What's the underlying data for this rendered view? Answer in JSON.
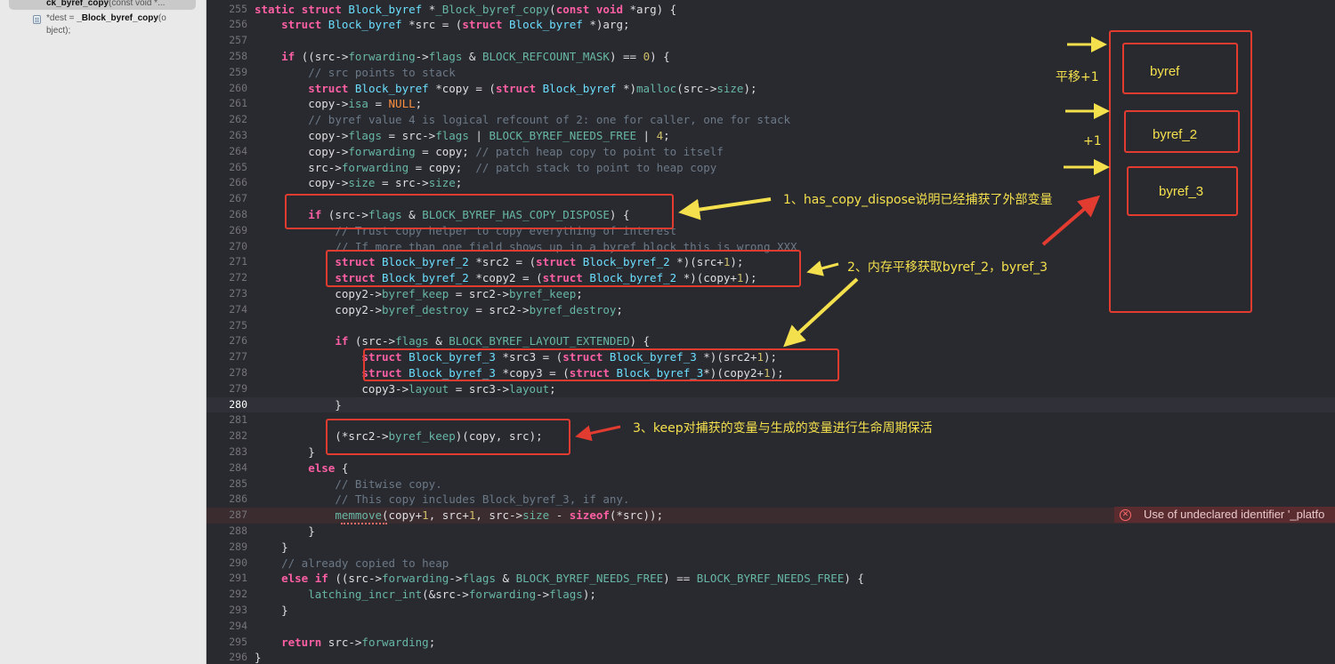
{
  "sidebar": {
    "selected_title": "ck_byref_copy",
    "selected_suffix": "(const void *...",
    "item_prefix": "*dest = ",
    "item_name": "_Block_byref_copy",
    "item_suffix": "(o",
    "item_line2": "bject);"
  },
  "editor": {
    "current_line": 280,
    "error_line": 287,
    "lines": [
      {
        "n": 255,
        "t": "static struct Block_byref *_Block_byref_copy(const void *arg) {"
      },
      {
        "n": 256,
        "t": "    struct Block_byref *src = (struct Block_byref *)arg;"
      },
      {
        "n": 257,
        "t": ""
      },
      {
        "n": 258,
        "t": "    if ((src->forwarding->flags & BLOCK_REFCOUNT_MASK) == 0) {"
      },
      {
        "n": 259,
        "t": "        // src points to stack"
      },
      {
        "n": 260,
        "t": "        struct Block_byref *copy = (struct Block_byref *)malloc(src->size);"
      },
      {
        "n": 261,
        "t": "        copy->isa = NULL;"
      },
      {
        "n": 262,
        "t": "        // byref value 4 is logical refcount of 2: one for caller, one for stack"
      },
      {
        "n": 263,
        "t": "        copy->flags = src->flags | BLOCK_BYREF_NEEDS_FREE | 4;"
      },
      {
        "n": 264,
        "t": "        copy->forwarding = copy; // patch heap copy to point to itself"
      },
      {
        "n": 265,
        "t": "        src->forwarding = copy;  // patch stack to point to heap copy"
      },
      {
        "n": 266,
        "t": "        copy->size = src->size;"
      },
      {
        "n": 267,
        "t": ""
      },
      {
        "n": 268,
        "t": "        if (src->flags & BLOCK_BYREF_HAS_COPY_DISPOSE) {"
      },
      {
        "n": 269,
        "t": "            // Trust copy helper to copy everything of interest"
      },
      {
        "n": 270,
        "t": "            // If more than one field shows up in a byref block this is wrong XXX"
      },
      {
        "n": 271,
        "t": "            struct Block_byref_2 *src2 = (struct Block_byref_2 *)(src+1);"
      },
      {
        "n": 272,
        "t": "            struct Block_byref_2 *copy2 = (struct Block_byref_2 *)(copy+1);"
      },
      {
        "n": 273,
        "t": "            copy2->byref_keep = src2->byref_keep;"
      },
      {
        "n": 274,
        "t": "            copy2->byref_destroy = src2->byref_destroy;"
      },
      {
        "n": 275,
        "t": ""
      },
      {
        "n": 276,
        "t": "            if (src->flags & BLOCK_BYREF_LAYOUT_EXTENDED) {"
      },
      {
        "n": 277,
        "t": "                struct Block_byref_3 *src3 = (struct Block_byref_3 *)(src2+1);"
      },
      {
        "n": 278,
        "t": "                struct Block_byref_3 *copy3 = (struct Block_byref_3*)(copy2+1);"
      },
      {
        "n": 279,
        "t": "                copy3->layout = src3->layout;"
      },
      {
        "n": 280,
        "t": "            }"
      },
      {
        "n": 281,
        "t": ""
      },
      {
        "n": 282,
        "t": "            (*src2->byref_keep)(copy, src);"
      },
      {
        "n": 283,
        "t": "        }"
      },
      {
        "n": 284,
        "t": "        else {"
      },
      {
        "n": 285,
        "t": "            // Bitwise copy."
      },
      {
        "n": 286,
        "t": "            // This copy includes Block_byref_3, if any."
      },
      {
        "n": 287,
        "t": "            memmove(copy+1, src+1, src->size - sizeof(*src));"
      },
      {
        "n": 288,
        "t": "        }"
      },
      {
        "n": 289,
        "t": "    }"
      },
      {
        "n": 290,
        "t": "    // already copied to heap"
      },
      {
        "n": 291,
        "t": "    else if ((src->forwarding->flags & BLOCK_BYREF_NEEDS_FREE) == BLOCK_BYREF_NEEDS_FREE) {"
      },
      {
        "n": 292,
        "t": "        latching_incr_int(&src->forwarding->flags);"
      },
      {
        "n": 293,
        "t": "    }"
      },
      {
        "n": 294,
        "t": ""
      },
      {
        "n": 295,
        "t": "    return src->forwarding;"
      },
      {
        "n": 296,
        "t": "}"
      }
    ]
  },
  "error": {
    "icon": "error-circle-icon",
    "message": "Use of undeclared identifier '_platfo"
  },
  "annotations": {
    "note1": "1、has_copy_dispose说明已经捕获了外部变量",
    "note2": "2、内存平移获取byref_2，byref_3",
    "note3": "3、keep对捕获的变量与生成的变量进行生命周期保活",
    "shift_label": "平移+1",
    "plus_label": "+1",
    "block_byref": "byref",
    "block_byref_2": "byref_2",
    "block_byref_3": "byref_3"
  },
  "colors": {
    "keyword": "#fc5fa3",
    "type": "#6bdfff",
    "function": "#67b7a4",
    "macro": "#fd8f3f",
    "comment": "#6c7986",
    "number": "#d0bf69",
    "annotation_box": "#e23b30",
    "annotation_text": "#f4e04d"
  }
}
